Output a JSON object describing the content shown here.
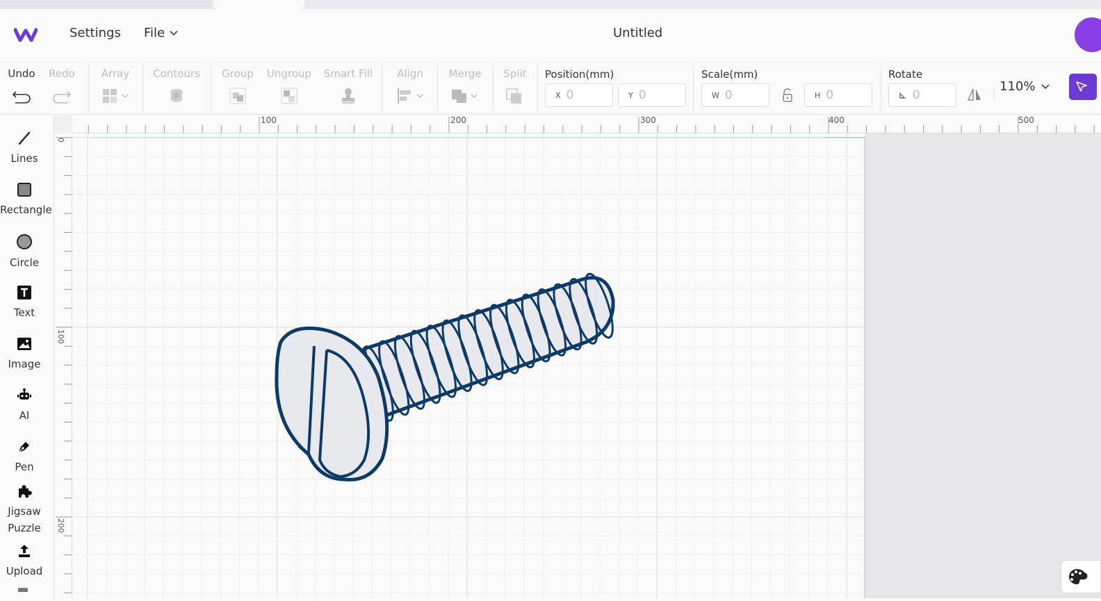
{
  "header": {
    "settings_label": "Settings",
    "file_label": "File",
    "title": "Untitled"
  },
  "toolbar": {
    "undo": "Undo",
    "redo": "Redo",
    "array": "Array",
    "contours": "Contours",
    "group": "Group",
    "ungroup": "Ungroup",
    "smart_fill": "Smart Fill",
    "align": "Align",
    "merge": "Merge",
    "split": "Split",
    "position_label": "Position(mm)",
    "x_prefix": "X",
    "x_value": "0",
    "y_prefix": "Y",
    "y_value": "0",
    "scale_label": "Scale(mm)",
    "w_prefix": "W",
    "w_value": "0",
    "h_prefix": "H",
    "h_value": "0",
    "rotate_label": "Rotate",
    "rotate_value": "0",
    "zoom": "110%"
  },
  "left_tools": [
    {
      "label": "Lines",
      "icon": "line-icon"
    },
    {
      "label": "Rectangle",
      "icon": "rectangle-icon"
    },
    {
      "label": "Circle",
      "icon": "circle-icon"
    },
    {
      "label": "Text",
      "icon": "text-icon"
    },
    {
      "label": "Image",
      "icon": "image-icon"
    },
    {
      "label": "AI",
      "icon": "robot-icon"
    },
    {
      "label": "Pen",
      "icon": "pen-icon"
    },
    {
      "label": "Jigsaw Puzzle",
      "icon": "puzzle-icon"
    },
    {
      "label": "Upload",
      "icon": "upload-icon"
    }
  ],
  "ruler": {
    "top_labels": [
      "100",
      "200",
      "300",
      "400",
      "500"
    ],
    "left_labels": [
      "0",
      "100",
      "200"
    ]
  },
  "colors": {
    "accent": "#6c3bd6",
    "avatar": "#8a3ee6",
    "screw_stroke": "#0d3a66",
    "screw_fill": "#e8e9ed"
  }
}
